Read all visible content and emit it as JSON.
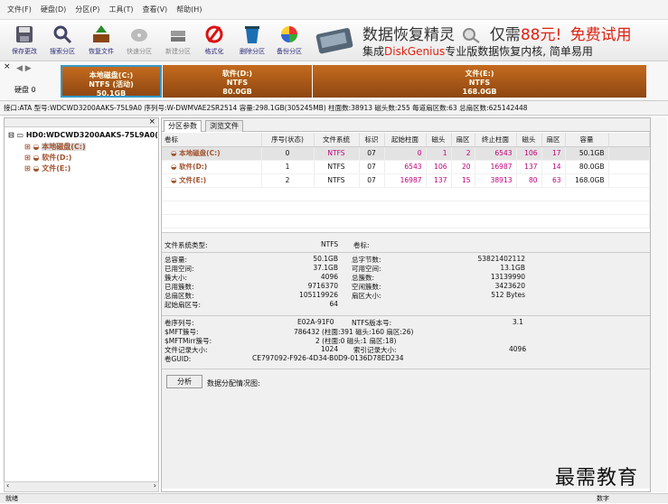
{
  "menu": [
    "文件(F)",
    "硬盘(D)",
    "分区(P)",
    "工具(T)",
    "查看(V)",
    "帮助(H)"
  ],
  "toolbar": [
    {
      "label": "保存更改",
      "icon": "save-icon"
    },
    {
      "label": "搜索分区",
      "icon": "search-icon"
    },
    {
      "label": "恢复文件",
      "icon": "recover-files-icon"
    },
    {
      "label": "快速分区",
      "icon": "quick-partition-icon"
    },
    {
      "label": "新建分区",
      "icon": "new-partition-icon"
    },
    {
      "label": "格式化",
      "icon": "format-icon"
    },
    {
      "label": "删除分区",
      "icon": "delete-icon"
    },
    {
      "label": "备份分区",
      "icon": "backup-icon"
    }
  ],
  "banner": {
    "line1_a": "数据恢复精灵",
    "line1_b": "仅需",
    "line1_c": "88元!",
    "line1_d": "免费试用",
    "line2_a": "集成",
    "line2_b": "DiskGenius",
    "line2_c": "专业版数据恢复内核, 简单易用"
  },
  "disk": {
    "label": "硬盘 0",
    "partitions": [
      {
        "name": "本地磁盘(C:)",
        "fs": "NTFS (活动)",
        "size": "50.1GB"
      },
      {
        "name": "软件(D:)",
        "fs": "NTFS",
        "size": "80.0GB"
      },
      {
        "name": "文件(E:)",
        "fs": "NTFS",
        "size": "168.0GB"
      }
    ],
    "info": "接口:ATA   型号:WDCWD3200AAKS-75L9A0   序列号:W-DWMVAE2SR2514   容量:298.1GB(305245MB)   柱面数:38913   磁头数:255   每道扇区数:63   总扇区数:625142448"
  },
  "tree": {
    "root": "HD0:WDCWD3200AAKS-75L9A0(",
    "children": [
      "本地磁盘(C:)",
      "软件(D:)",
      "文件(E:)"
    ]
  },
  "tabs": [
    "分区参数",
    "浏览文件"
  ],
  "table": {
    "headers": [
      "卷标",
      "序号(状态)",
      "文件系统",
      "标识",
      "起始柱面",
      "磁头",
      "扇区",
      "终止柱面",
      "磁头",
      "扇区",
      "容量"
    ],
    "rows": [
      [
        "本地磁盘(C:)",
        "0",
        "NTFS",
        "07",
        "0",
        "1",
        "2",
        "6543",
        "106",
        "17",
        "50.1GB"
      ],
      [
        "软件(D:)",
        "1",
        "NTFS",
        "07",
        "6543",
        "106",
        "20",
        "16987",
        "137",
        "14",
        "80.0GB"
      ],
      [
        "文件(E:)",
        "2",
        "NTFS",
        "07",
        "16987",
        "137",
        "15",
        "38913",
        "80",
        "63",
        "168.0GB"
      ]
    ]
  },
  "fsinfo": {
    "type_label": "文件系统类型:",
    "type_value": "NTFS",
    "vol_label": "卷标:",
    "left": [
      [
        "总容量:",
        "50.1GB"
      ],
      [
        "已用空间:",
        "37.1GB"
      ],
      [
        "簇大小:",
        "4096"
      ],
      [
        "已用簇数:",
        "9716370"
      ],
      [
        "总扇区数:",
        "105119926"
      ],
      [
        "起始扇区号:",
        "64"
      ]
    ],
    "right": [
      [
        "总字节数:",
        "53821402112"
      ],
      [
        "可用空间:",
        "13.1GB"
      ],
      [
        "总簇数:",
        "13139990"
      ],
      [
        "空闲簇数:",
        "3423620"
      ],
      [
        "扇区大小:",
        "512 Bytes"
      ]
    ],
    "serial_label": "卷序列号:",
    "serial_value": "E02A-91F0",
    "ntfs_ver_label": "NTFS版本号:",
    "ntfs_ver_value": "3.1",
    "mft_label": "$MFT簇号:",
    "mft_value": "786432 (柱面:391 磁头:160 扇区:26)",
    "mftmirr_label": "$MFTMirr簇号:",
    "mftmirr_value": "2 (柱面:0 磁头:1 扇区:18)",
    "frs_label": "文件记录大小:",
    "frs_value": "1024",
    "irs_label": "索引记录大小:",
    "irs_value": "4096",
    "guid_label": "卷GUID:",
    "guid_value": "CE797092-F926-4D34-B0D9-0136D78ED234"
  },
  "analyze_button": "分析",
  "analyze_label": "数据分配情况图:",
  "status_left": "就绪",
  "status_right": "数字",
  "watermark": "最需教育"
}
